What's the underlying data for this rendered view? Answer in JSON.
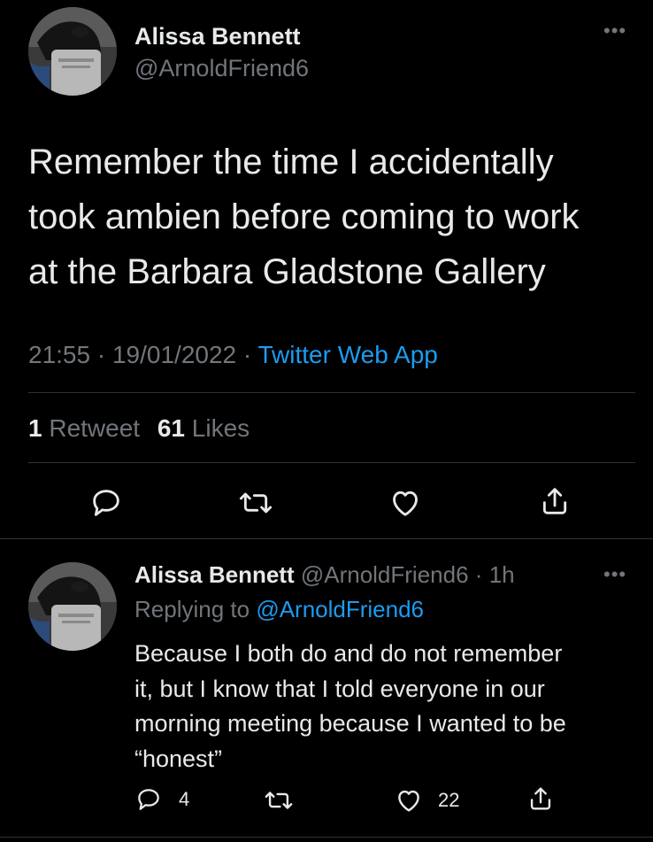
{
  "main_tweet": {
    "author_name": "Alissa Bennett",
    "author_handle": "@ArnoldFriend6",
    "text_lines": [
      "Remember the time I accidentally",
      "took ambien before coming to work",
      "at the Barbara Gladstone Gallery"
    ],
    "time": "21:55",
    "date": "19/01/2022",
    "source": "Twitter Web App",
    "retweet_count": "1",
    "retweet_label": "Retweet",
    "like_count": "61",
    "like_label": "Likes",
    "more_icon": "more-horizontal-icon",
    "actions": [
      "reply-icon",
      "retweet-icon",
      "like-icon",
      "share-icon"
    ]
  },
  "reply_tweet": {
    "author_name": "Alissa Bennett",
    "author_handle": "@ArnoldFriend6",
    "age": "1h",
    "replying_label": "Replying to",
    "replying_to": "@ArnoldFriend6",
    "text_lines": [
      "Because I both do and do not remember",
      "it, but I know that I told everyone in our",
      "morning meeting because I wanted to be",
      "“honest”"
    ],
    "reply_count": "4",
    "like_count": "22",
    "more_icon": "more-horizontal-icon",
    "actions": [
      "reply-icon",
      "retweet-icon",
      "like-icon",
      "share-icon"
    ]
  },
  "colors": {
    "background": "#000000",
    "text": "#e7e9ea",
    "muted": "#71767b",
    "accent": "#1d9bf0",
    "divider": "#2f3336"
  }
}
